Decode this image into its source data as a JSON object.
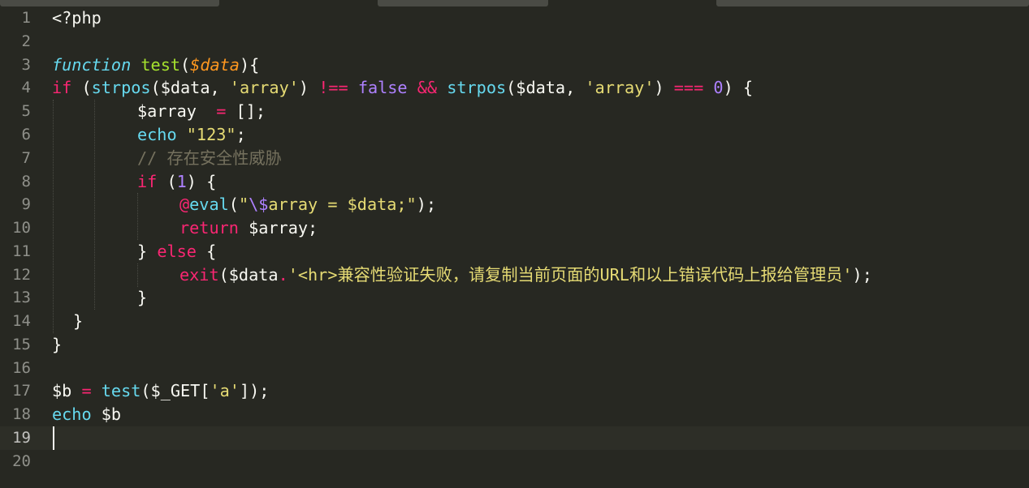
{
  "colors": {
    "background": "#272822",
    "keyword": "#f92672",
    "storage": "#66d9ef",
    "function_name": "#a6e22e",
    "string": "#e6db74",
    "number": "#ae81ff",
    "parameter": "#fd971f",
    "comment": "#75715e",
    "text": "#f8f8f2",
    "gutter_text": "#8f908a"
  },
  "editor": {
    "line_numbers": [
      "1",
      "2",
      "3",
      "4",
      "5",
      "6",
      "7",
      "8",
      "9",
      "10",
      "11",
      "12",
      "13",
      "14",
      "15",
      "16",
      "17",
      "18",
      "19",
      "20"
    ],
    "active_line": 19,
    "lines": {
      "l1": {
        "t1": "<?php"
      },
      "l3": {
        "t1": "function",
        "t2": " ",
        "t3": "test",
        "t4": "(",
        "t5": "$data",
        "t6": "){"
      },
      "l4": {
        "t1": "if",
        "t2": " (",
        "t3": "strpos",
        "t4": "($data, ",
        "t5": "'array'",
        "t6": ") ",
        "t7": "!==",
        "t8": " ",
        "t9": "false",
        "t10": " ",
        "t11": "&&",
        "t12": " ",
        "t13": "strpos",
        "t14": "($data, ",
        "t15": "'array'",
        "t16": ") ",
        "t17": "===",
        "t18": " ",
        "t19": "0",
        "t20": ") {"
      },
      "l5": {
        "t1": "$array  ",
        "t2": "=",
        "t3": " [];"
      },
      "l6": {
        "t1": "echo",
        "t2": " ",
        "t3": "\"123\"",
        "t4": ";"
      },
      "l7": {
        "t1": "// 存在安全性威胁"
      },
      "l8": {
        "t1": "if",
        "t2": " (",
        "t3": "1",
        "t4": ") {"
      },
      "l9": {
        "t1": "@",
        "t2": "eval",
        "t3": "(",
        "t4": "\"",
        "t5": "\\$",
        "t6": "array = $data;\"",
        "t7": ");"
      },
      "l10": {
        "t1": "return",
        "t2": " $array;"
      },
      "l11": {
        "t1": "} ",
        "t2": "else",
        "t3": " {"
      },
      "l12": {
        "t1": "exit",
        "t2": "($data",
        "t3": ".",
        "t4": "'<hr>兼容性验证失败，请复制当前页面的URL和以上错误代码上报给管理员'",
        "t5": ");"
      },
      "l13": {
        "t1": "}"
      },
      "l14": {
        "t1": "}"
      },
      "l15": {
        "t1": "}"
      },
      "l17": {
        "t1": "$b ",
        "t2": "=",
        "t3": " ",
        "t4": "test",
        "t5": "($_GET[",
        "t6": "'a'",
        "t7": "]);"
      },
      "l18": {
        "t1": "echo",
        "t2": " $b"
      }
    }
  }
}
